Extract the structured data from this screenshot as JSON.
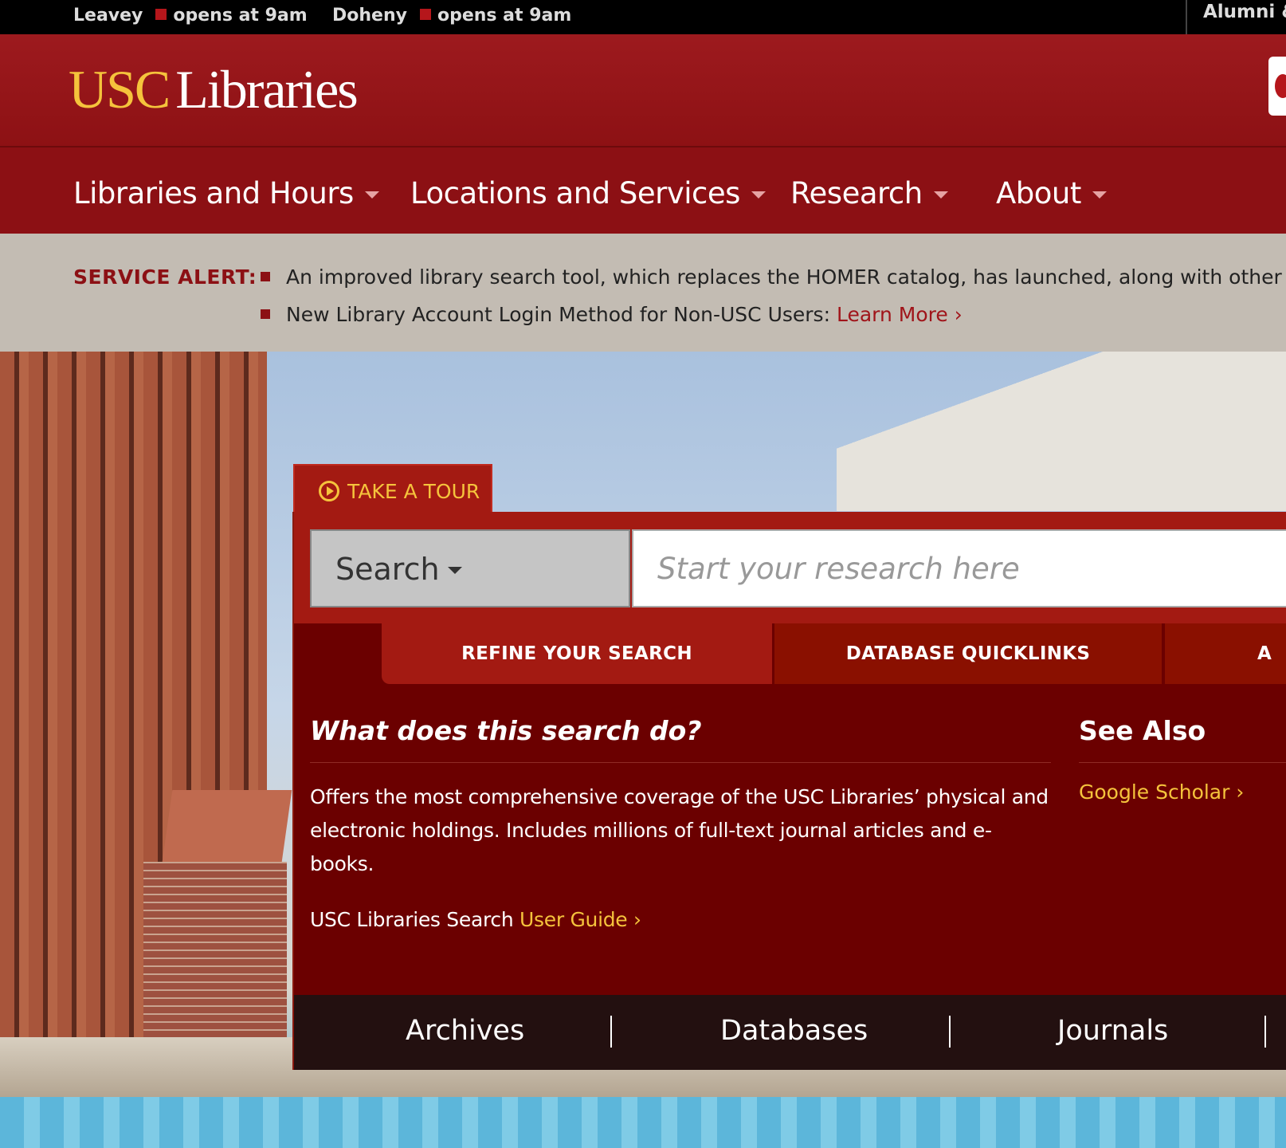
{
  "topbar": {
    "hours": [
      {
        "library": "Leavey",
        "status": "opens at 9am"
      },
      {
        "library": "Doheny",
        "status": "opens at 9am"
      }
    ],
    "alumni_label": "Alumni &"
  },
  "header": {
    "logo_usc": "USC",
    "logo_libraries": "Libraries"
  },
  "nav": {
    "items": [
      {
        "label": "Libraries and Hours"
      },
      {
        "label": "Locations and Services"
      },
      {
        "label": "Research"
      },
      {
        "label": "About"
      }
    ]
  },
  "alert": {
    "label": "SERVICE ALERT:",
    "items": [
      {
        "text": "An improved library search tool, which replaces the HOMER catalog, has launched, along with other upg"
      },
      {
        "text": "New Library Account Login Method for Non-USC Users: ",
        "link": "Learn More ›"
      }
    ]
  },
  "tour": {
    "label": "TAKE A TOUR"
  },
  "search": {
    "dropdown_label": "Search",
    "placeholder": "Start your research here",
    "tabs": [
      {
        "label": "REFINE YOUR SEARCH"
      },
      {
        "label": "DATABASE QUICKLINKS"
      },
      {
        "label": "A"
      }
    ],
    "info": {
      "heading": "What does this search do?",
      "description": "Offers the most comprehensive coverage of the USC Libraries’ physical and electronic holdings. Includes millions of full-text journal articles and e-books.",
      "guide_prefix": "USC Libraries Search ",
      "guide_link": "User Guide ›"
    },
    "see_also": {
      "heading": "See Also",
      "links": [
        {
          "label": "Google Scholar ›"
        }
      ]
    }
  },
  "quicklinks": [
    {
      "label": "Archives"
    },
    {
      "label": "Databases"
    },
    {
      "label": "Journals"
    }
  ],
  "colors": {
    "cardinal": "#8c1014",
    "gold": "#f5c33c",
    "panel": "#6b0000"
  }
}
